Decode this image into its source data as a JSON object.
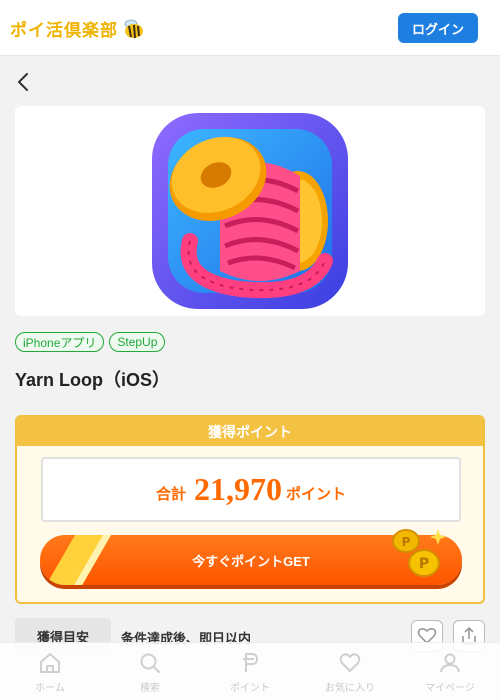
{
  "header": {
    "logo_text": "ポイ活倶楽部",
    "login_label": "ログイン"
  },
  "app": {
    "tags": [
      "iPhoneアプリ",
      "StepUp"
    ],
    "title": "Yarn Loop（iOS）"
  },
  "points": {
    "header": "獲得ポイント",
    "total_label": "合計",
    "total_value": "21,970",
    "total_unit": "ポイント",
    "get_button": "今すぐポイントGET"
  },
  "info": {
    "label": "獲得目安",
    "value": "条件達成後、即日以内"
  },
  "bottom_nav": [
    {
      "label": "ホーム",
      "icon": "home-icon"
    },
    {
      "label": "検索",
      "icon": "search-icon"
    },
    {
      "label": "ポイント",
      "icon": "point-icon"
    },
    {
      "label": "お気に入り",
      "icon": "heart-icon"
    },
    {
      "label": "マイページ",
      "icon": "user-icon"
    }
  ],
  "colors": {
    "accent_blue": "#1f7fe0",
    "brand_yellow": "#f0b400",
    "points_orange": "#ff6a00",
    "tag_green": "#24a83a"
  }
}
